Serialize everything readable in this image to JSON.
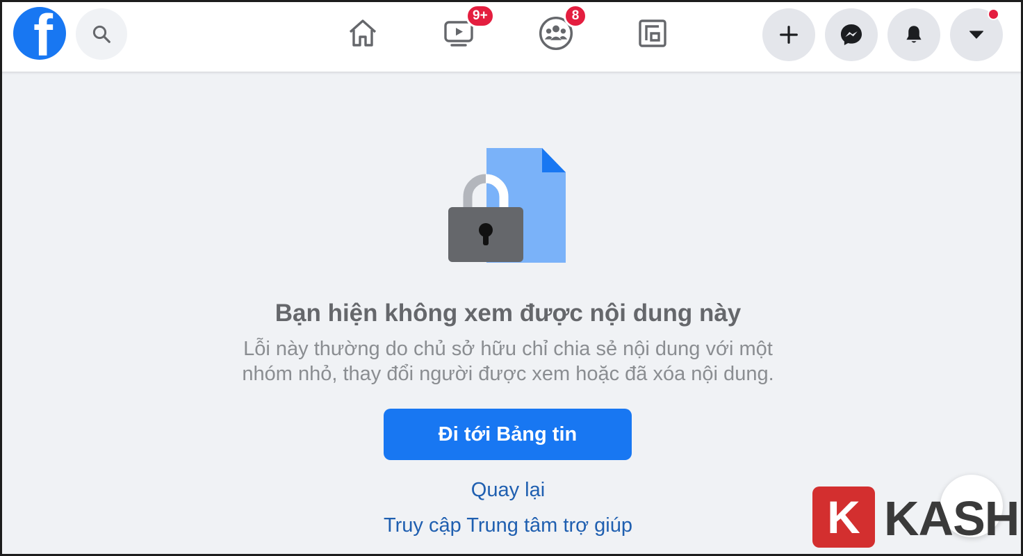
{
  "nav": {
    "logo_letter": "f",
    "video_badge": "9+",
    "groups_badge": "8"
  },
  "icons": {
    "logo": "facebook-logo",
    "search": "search-icon",
    "home": "home-icon",
    "watch": "watch-icon",
    "groups": "groups-icon",
    "gaming": "gaming-icon",
    "create": "plus-icon",
    "messenger": "messenger-icon",
    "notifications": "bell-icon",
    "account": "caret-down-icon",
    "illustration": "locked-document-icon"
  },
  "content": {
    "title": "Bạn hiện không xem được nội dung này",
    "description_line1": "Lỗi này thường do chủ sở hữu chỉ chia sẻ nội dung với một",
    "description_line2": "nhóm nhỏ, thay đổi người được xem hoặc đã xóa nội dung.",
    "primary_button": "Đi tới Bảng tin",
    "back_link": "Quay lại",
    "help_link": "Truy cập Trung tâm trợ giúp"
  },
  "watermark": {
    "letter": "K",
    "text": "KASHI"
  },
  "colors": {
    "brand_blue": "#1877f2",
    "badge_red": "#e41e3f",
    "page_background": "#f0f2f5",
    "link_blue": "#1f5fb0"
  }
}
